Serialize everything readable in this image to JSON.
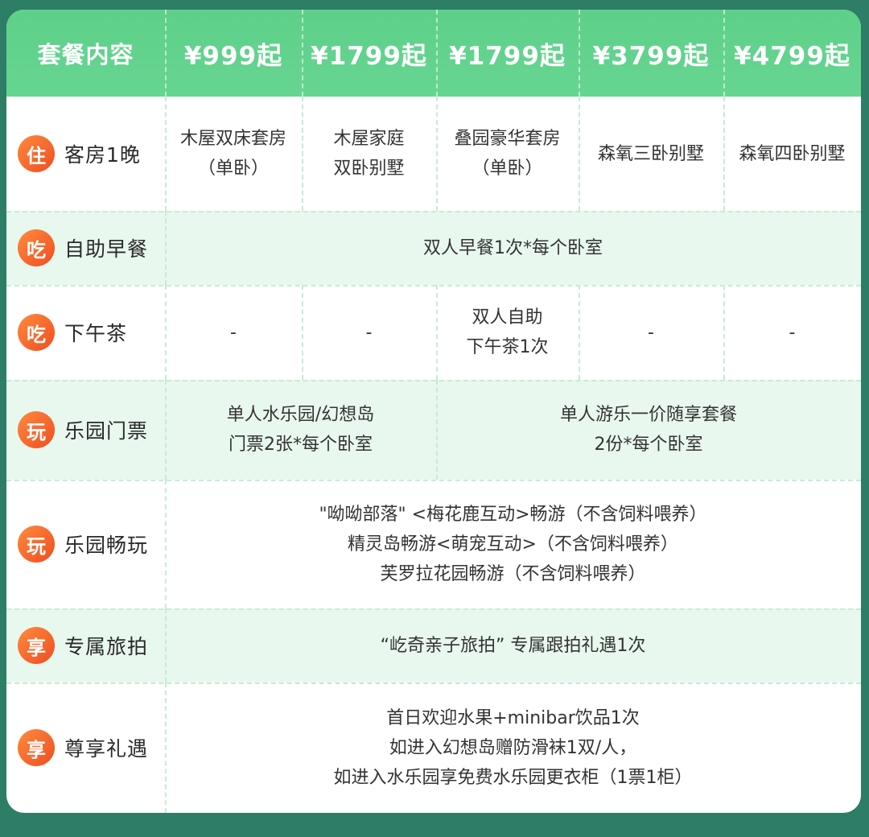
{
  "header": {
    "title": "套餐内容",
    "prices": [
      "¥999起",
      "¥1799起",
      "¥1799起",
      "¥3799起",
      "¥4799起"
    ]
  },
  "rows": [
    {
      "badge": "住",
      "label": "客房1晚",
      "cells": [
        "木屋双床套房\n（单卧）",
        "木屋家庭\n双卧别墅",
        "叠园豪华套房\n（单卧）",
        "森氧三卧别墅",
        "森氧四卧别墅"
      ]
    },
    {
      "badge": "吃",
      "label": "自助早餐",
      "text": "双人早餐1次*每个卧室"
    },
    {
      "badge": "吃",
      "label": "下午茶",
      "cells": [
        "-",
        "-",
        "双人自助\n下午茶1次",
        "-",
        "-"
      ]
    },
    {
      "badge": "玩",
      "label": "乐园门票",
      "left": "单人水乐园/幻想岛\n门票2张*每个卧室",
      "right": "单人游乐一价随享套餐\n2份*每个卧室"
    },
    {
      "badge": "玩",
      "label": "乐园畅玩",
      "text": "\"呦呦部落\" <梅花鹿互动>畅游（不含饲料喂养）\n精灵岛畅游<萌宠互动>（不含饲料喂养）\n芙罗拉花园畅游（不含饲料喂养）"
    },
    {
      "badge": "享",
      "label": "专属旅拍",
      "text": "“屹奇亲子旅拍” 专属跟拍礼遇1次"
    },
    {
      "badge": "享",
      "label": "尊享礼遇",
      "text": "首日欢迎水果+minibar饮品1次\n如进入幻想岛赠防滑袜1双/人，\n如进入水乐园享免费水乐园更衣柜（1票1柜）"
    }
  ]
}
